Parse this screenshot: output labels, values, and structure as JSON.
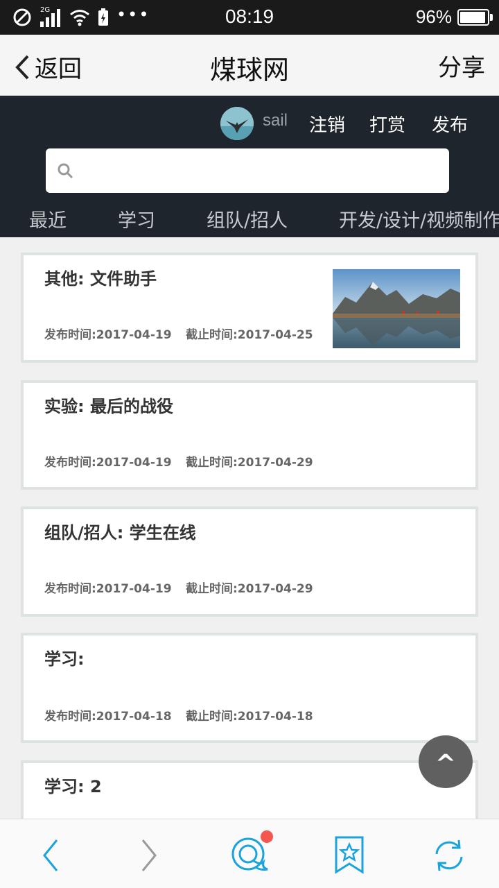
{
  "status_bar": {
    "network": "2G",
    "time": "08:19",
    "battery": "96%",
    "battery_level": 0.96
  },
  "nav": {
    "back_label": "返回",
    "title": "煤球网",
    "share_label": "分享"
  },
  "header": {
    "user_name": "sail",
    "links": [
      "注销",
      "打赏",
      "发布"
    ],
    "search_placeholder": "",
    "tabs": [
      "最近",
      "学习",
      "组队/招人",
      "开发/设计/视频制作"
    ]
  },
  "posts": [
    {
      "title": "其他: 文件助手",
      "published": "发布时间:2017-04-19",
      "deadline": "截止时间:2017-04-25",
      "has_image": true
    },
    {
      "title": "实验: 最后的战役",
      "published": "发布时间:2017-04-19",
      "deadline": "截止时间:2017-04-29",
      "has_image": false
    },
    {
      "title": "组队/招人: 学生在线",
      "published": "发布时间:2017-04-19",
      "deadline": "截止时间:2017-04-29",
      "has_image": false
    },
    {
      "title": "学习:",
      "published": "发布时间:2017-04-18",
      "deadline": "截止时间:2017-04-18",
      "has_image": false
    },
    {
      "title": "学习: 2",
      "published": "",
      "deadline": "",
      "has_image": false
    }
  ],
  "back_to_top_label": "^",
  "colors": {
    "header_bg": "#1f252d",
    "accent": "#1aa3dc",
    "badge": "#f4574f"
  }
}
